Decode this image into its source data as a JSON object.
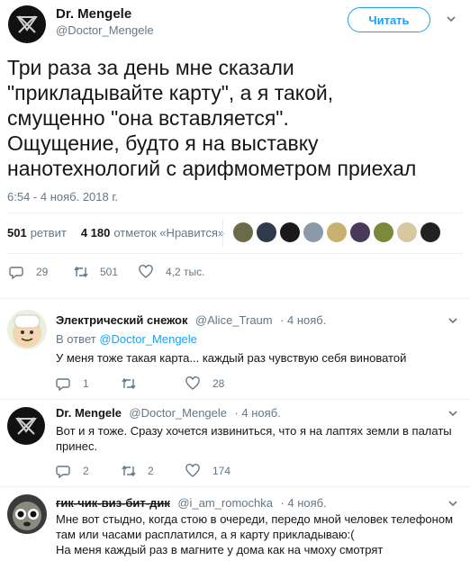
{
  "main_tweet": {
    "author_name": "Dr. Mengele",
    "author_handle": "@Doctor_Mengele",
    "follow_label": "Читать",
    "text": "Три раза за день мне сказали\n\"прикладывайте карту\", а я такой,\nсмущенно \"она вставляется\".\nОщущение, будто я на выставку\nнанотехнологий с арифмометром приехал",
    "timestamp": "6:54 - 4 нояб. 2018 г.",
    "retweets_count": "501",
    "retweets_label": "ретвит",
    "likes_count": "4 180",
    "likes_label": "отметок «Нравится»",
    "actions": {
      "replies": "29",
      "retweets": "501",
      "likes": "4,2 тыс."
    }
  },
  "likers_colors": [
    "#6b6b4a",
    "#2f3a4a",
    "#1a1a1a",
    "#8a9aa8",
    "#c8b070",
    "#4a3a5a",
    "#7a8a3a",
    "#d8c8a0",
    "#222222"
  ],
  "replies": [
    {
      "name": "Электрический снежок",
      "handle": "@Alice_Traum",
      "date": "· 4 нояб.",
      "reply_to_prefix": "В ответ ",
      "reply_to_handle": "@Doctor_Mengele",
      "text": "У меня тоже такая карта... каждый раз чувствую себя виноватой",
      "replies": "1",
      "retweets": "",
      "likes": "28"
    },
    {
      "name": "Dr. Mengele",
      "handle": "@Doctor_Mengele",
      "date": "· 4 нояб.",
      "text": "Вот и я тоже. Сразу хочется извиниться, что я на лаптях земли  в палаты\nпринес.",
      "replies": "2",
      "retweets": "2",
      "likes": "174"
    },
    {
      "name": "гик-чик-виз-бит-дик",
      "handle": "@i_am_romochka",
      "date": "· 4 нояб.",
      "text": "Мне вот стыдно, когда стою в очереди, передо мной человек телефоном\nтам или часами расплатился, а я карту прикладываю:(\nНа меня каждый раз в магните у дома как на чмоху смотрят"
    }
  ]
}
